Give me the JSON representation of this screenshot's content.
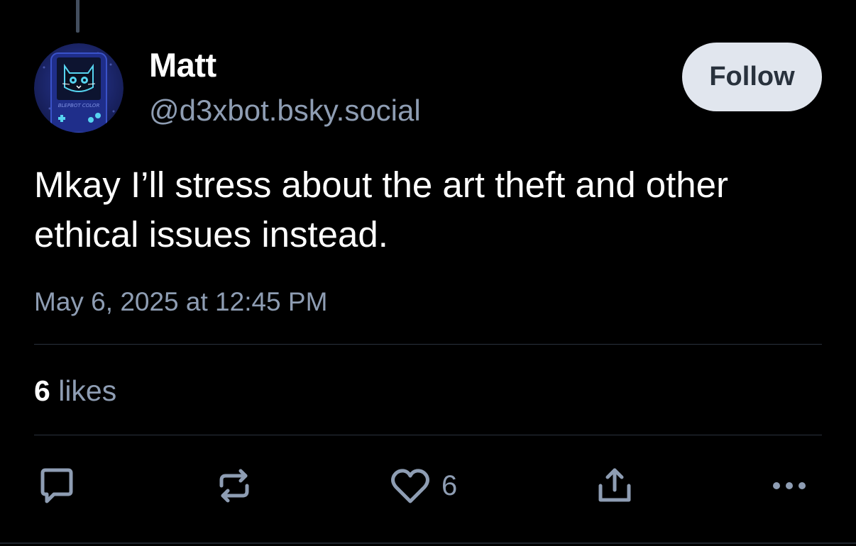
{
  "author": {
    "display_name": "Matt",
    "handle": "@d3xbot.bsky.social",
    "avatar_label": "BLEPBOT COLOR"
  },
  "follow_label": "Follow",
  "post": {
    "text": "Mkay I’ll stress about the art theft and other ethical issues instead.",
    "timestamp": "May 6, 2025 at 12:45 PM"
  },
  "stats": {
    "likes_count": "6",
    "likes_label": "likes"
  },
  "actions": {
    "reply_icon": "reply-icon",
    "repost_icon": "repost-icon",
    "like_icon": "heart-icon",
    "like_count": "6",
    "share_icon": "share-icon",
    "more_icon": "more-icon"
  },
  "colors": {
    "background": "#000000",
    "primary_text": "#ffffff",
    "secondary_text": "#8e9db3",
    "follow_button_bg": "#e1e6ee",
    "follow_button_text": "#29323d",
    "divider": "#2a323d"
  }
}
